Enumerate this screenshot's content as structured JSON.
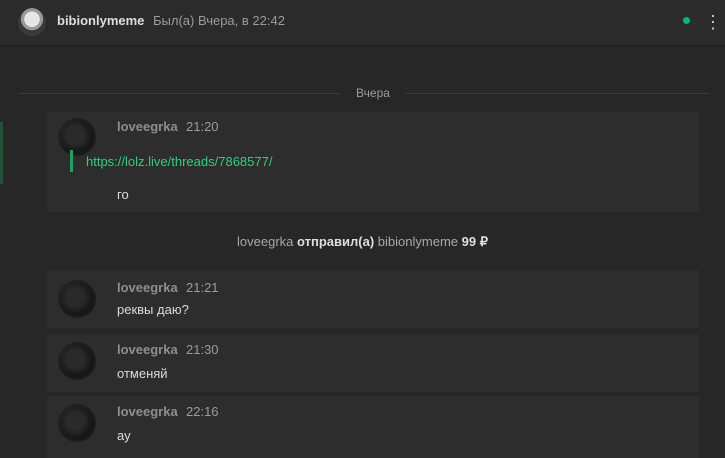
{
  "header": {
    "name": "bibionlymeme",
    "status": "Был(а) Вчера, в 22:42",
    "online": true
  },
  "day_separator": "Вчера",
  "messages": [
    {
      "author": "loveegrka",
      "time": "21:20",
      "link": "https://lolz.live/threads/7868577/",
      "text": "го"
    },
    {
      "author": "loveegrka",
      "time": "21:21",
      "text": "реквы даю?"
    },
    {
      "author": "loveegrka",
      "time": "21:30",
      "text": "отменяй"
    },
    {
      "author": "loveegrka",
      "time": "22:16",
      "text": "ау"
    }
  ],
  "transfer_notice": {
    "sender": "loveegrka",
    "action": "отправил(а)",
    "recipient": "bibionlymeme",
    "amount": "99 ₽"
  },
  "colors": {
    "accent_green": "#2bd17e",
    "online_dot": "#00ba78",
    "background": "#272727"
  }
}
